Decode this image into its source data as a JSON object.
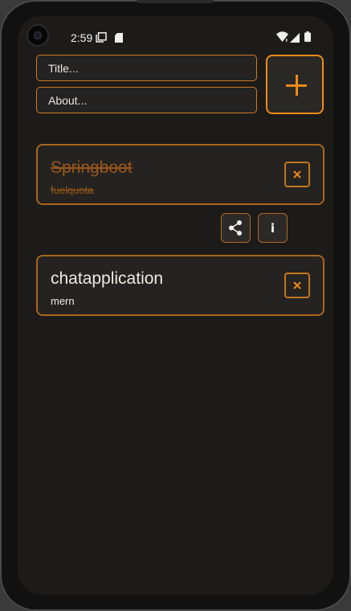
{
  "status_bar": {
    "time": "2:59"
  },
  "inputs": {
    "title_placeholder": "Title...",
    "about_placeholder": "About..."
  },
  "add_button": {
    "icon": "plus-icon"
  },
  "cards": [
    {
      "title": "Springboot",
      "subtitle": "fuelquota",
      "completed": true
    },
    {
      "title": "chatapplication",
      "subtitle": "mern",
      "completed": false
    }
  ],
  "card_actions": {
    "share_icon": "share-icon",
    "info_label": "i"
  },
  "colors": {
    "accent": "#f08a17",
    "card_border": "#a9651d",
    "completed_text": "#9a561a",
    "background": "#1c1b19"
  }
}
